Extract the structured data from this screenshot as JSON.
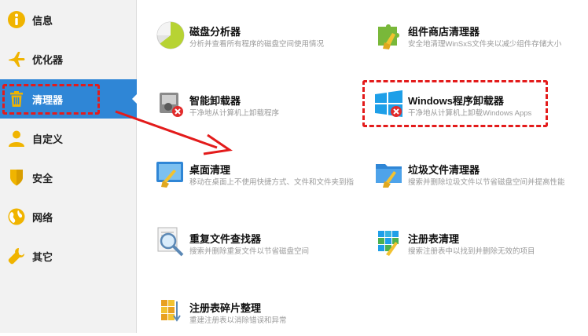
{
  "sidebar": {
    "items": [
      {
        "label": "信息",
        "icon": "info-icon"
      },
      {
        "label": "优化器",
        "icon": "airplane-icon"
      },
      {
        "label": "清理器",
        "icon": "trash-icon"
      },
      {
        "label": "自定义",
        "icon": "user-icon"
      },
      {
        "label": "安全",
        "icon": "shield-icon"
      },
      {
        "label": "网络",
        "icon": "globe-icon"
      },
      {
        "label": "其它",
        "icon": "wrench-icon"
      }
    ],
    "active": "清理器"
  },
  "tools": [
    {
      "title": "磁盘分析器",
      "desc": "分析并查看所有程序的磁盘空间使用情况",
      "icon": "pie-chart-icon"
    },
    {
      "title": "组件商店清理器",
      "desc": "安全地清理WinSxS文件夹以减少组件存储大小",
      "icon": "puzzle-broom-icon"
    },
    {
      "title": "智能卸载器",
      "desc": "干净地从计算机上卸载程序",
      "icon": "smart-uninstaller-icon"
    },
    {
      "title": "Windows程序卸载器",
      "desc": "干净地从计算机上卸载Windows Apps",
      "icon": "windows-uninstall-icon"
    },
    {
      "title": "桌面清理",
      "desc": "移动在桌面上不使用快捷方式、文件和文件夹到指",
      "icon": "desktop-broom-icon"
    },
    {
      "title": "垃圾文件清理器",
      "desc": "搜索并删除垃圾文件以节省磁盘空间并提高性能",
      "icon": "folder-broom-icon"
    },
    {
      "title": "重复文件查找器",
      "desc": "搜索并删除重复文件以节省磁盘空间",
      "icon": "magnifier-document-icon"
    },
    {
      "title": "注册表清理",
      "desc": "搜索注册表中以找到并删除无效的项目",
      "icon": "registry-broom-icon"
    },
    {
      "title": "注册表碎片整理",
      "desc": "重建注册表以消除错误和异常",
      "icon": "registry-defrag-icon"
    }
  ],
  "colors": {
    "accent": "#2f86d6",
    "annotation": "#e31b1b",
    "sidebar_bg": "#f2f2f2"
  }
}
